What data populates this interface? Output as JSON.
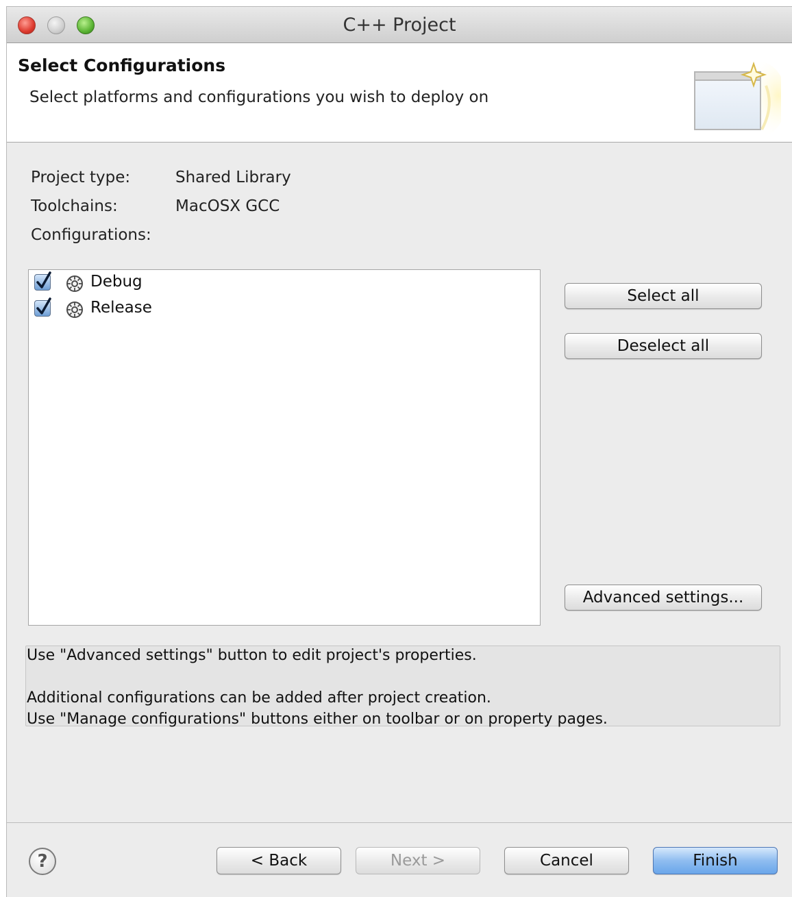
{
  "window": {
    "title": "C++ Project"
  },
  "header": {
    "title": "Select Configurations",
    "description": "Select platforms and configurations you wish to deploy on"
  },
  "fields": {
    "project_type_label": "Project type:",
    "project_type_value": "Shared Library",
    "toolchains_label": "Toolchains:",
    "toolchains_value": "MacOSX GCC",
    "configurations_label": "Configurations:"
  },
  "configurations": [
    {
      "label": "Debug",
      "checked": true
    },
    {
      "label": "Release",
      "checked": true
    }
  ],
  "side_buttons": {
    "select_all": "Select all",
    "deselect_all": "Deselect all",
    "advanced_settings": "Advanced settings..."
  },
  "info": {
    "line1": "Use \"Advanced settings\" button to edit project's properties.",
    "line2": "Additional configurations can be added after project creation.",
    "line3": "Use \"Manage configurations\" buttons either on toolbar or on property pages."
  },
  "footer": {
    "help": "?",
    "back": "< Back",
    "next": "Next >",
    "cancel": "Cancel",
    "finish": "Finish"
  },
  "colors": {
    "accent": "#6aa6ea",
    "window_bg": "#ececec"
  }
}
